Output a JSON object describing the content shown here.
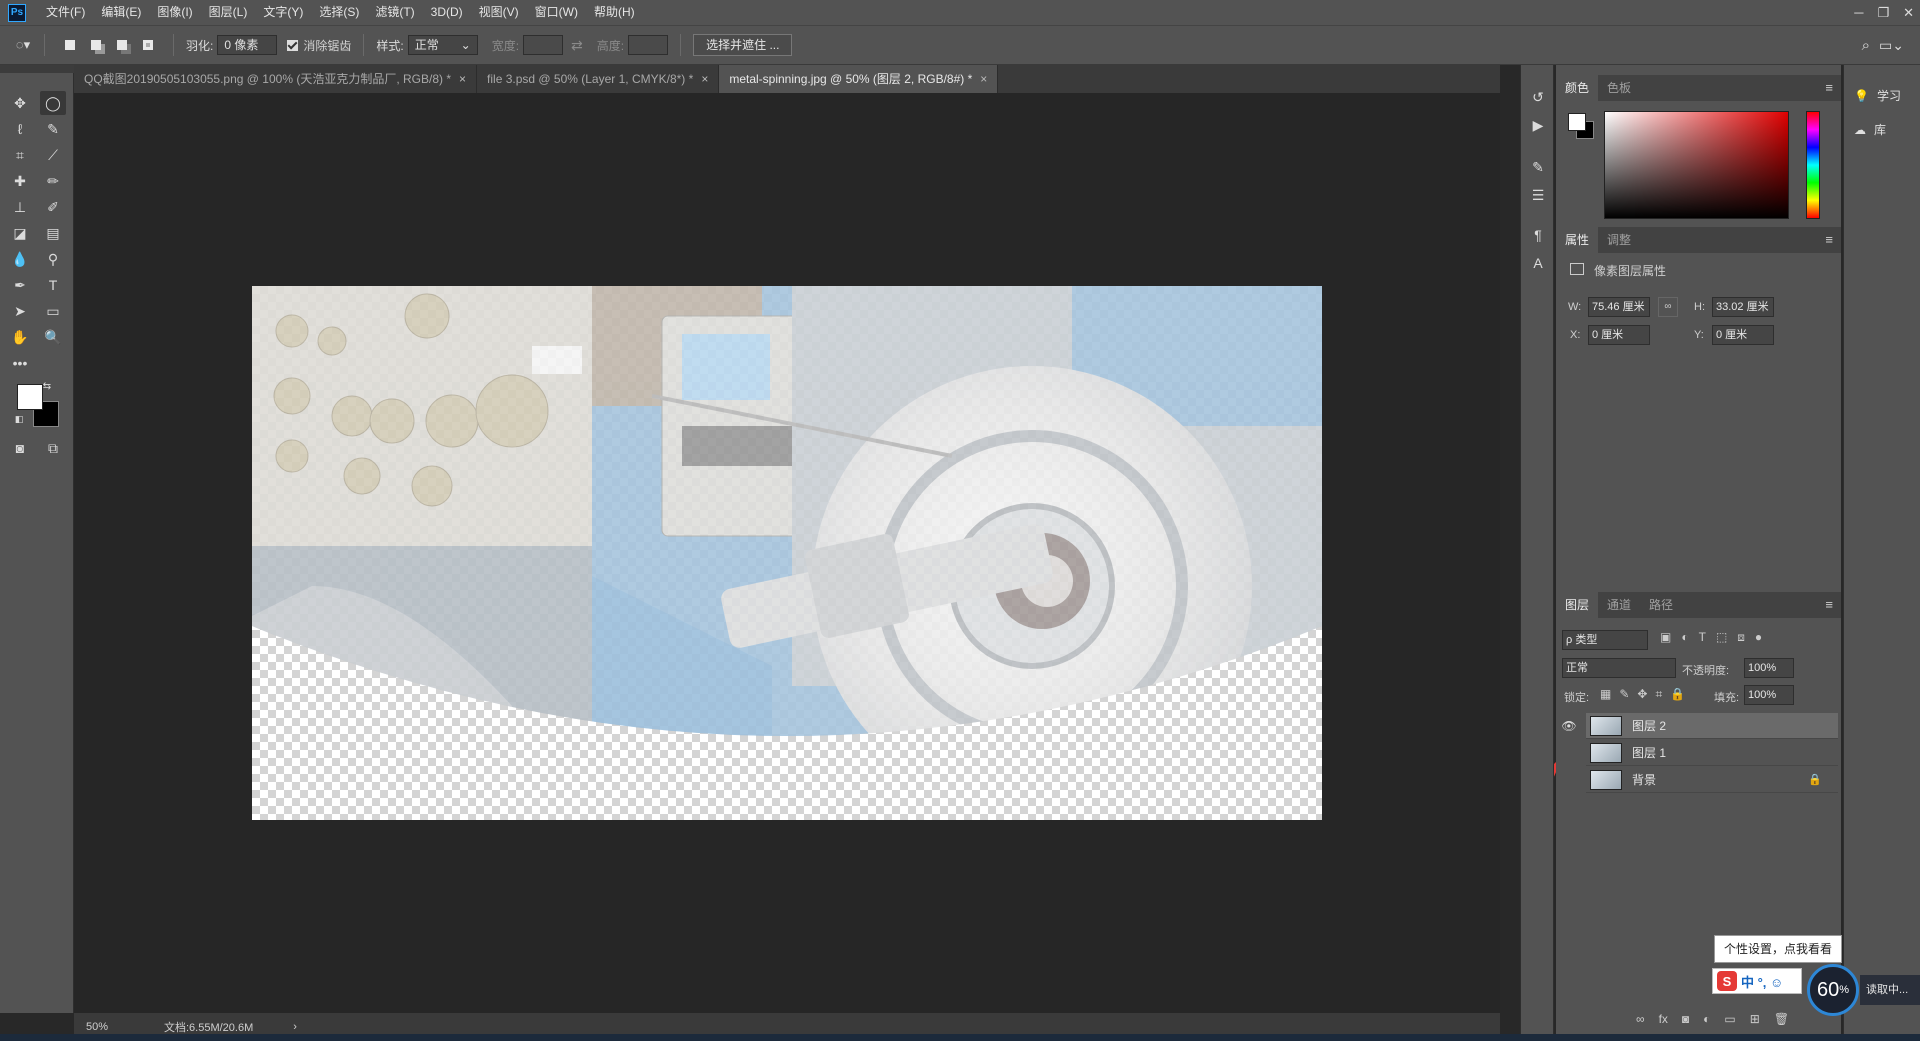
{
  "app": {
    "logo": "Ps"
  },
  "menu": [
    "文件(F)",
    "编辑(E)",
    "图像(I)",
    "图层(L)",
    "文字(Y)",
    "选择(S)",
    "滤镜(T)",
    "3D(D)",
    "视图(V)",
    "窗口(W)",
    "帮助(H)"
  ],
  "window_controls": {
    "minimize": "─",
    "restore": "❐",
    "close": "✕"
  },
  "options": {
    "feather_label": "羽化:",
    "feather_value": "0 像素",
    "antialias_label": "消除锯齿",
    "style_label": "样式:",
    "style_value": "正常",
    "width_label": "宽度:",
    "height_label": "高度:",
    "select_mask_button": "选择并遮住 ..."
  },
  "tabs": [
    {
      "label": "QQ截图20190505103055.png @ 100% (天浩亚克力制品厂, RGB/8) *",
      "close": "×"
    },
    {
      "label": "file 3.psd @ 50% (Layer 1, CMYK/8*) *",
      "close": "×"
    },
    {
      "label": "metal-spinning.jpg @ 50% (图层 2, RGB/8#) *",
      "close": "×"
    }
  ],
  "status": {
    "zoom": "50%",
    "doc_info": "文档:6.55M/20.6M",
    "arrow": "›"
  },
  "color_panel": {
    "tabs": [
      "颜色",
      "色板"
    ],
    "menu": "≡"
  },
  "properties_panel": {
    "tabs": [
      "属性",
      "调整"
    ],
    "menu": "≡",
    "title": "像素图层属性",
    "w_label": "W:",
    "w_value": "75.46 厘米",
    "h_label": "H:",
    "h_value": "33.02 厘米",
    "x_label": "X:",
    "x_value": "0 厘米",
    "y_label": "Y:",
    "y_value": "0 厘米"
  },
  "layers_panel": {
    "tabs": [
      "图层",
      "通道",
      "路径"
    ],
    "menu": "≡",
    "filter_value": "ρ 类型",
    "blend_mode": "正常",
    "opacity_label": "不透明度:",
    "opacity_value": "100%",
    "lock_label": "锁定:",
    "fill_label": "填充:",
    "fill_value": "100%",
    "layers": [
      {
        "name": "图层 2",
        "visible": true,
        "selected": true
      },
      {
        "name": "图层 1",
        "visible": false,
        "selected": false
      },
      {
        "name": "背景",
        "visible": false,
        "selected": false,
        "locked": true
      }
    ]
  },
  "right_column": {
    "learn": "学习",
    "library": "库"
  },
  "ime": {
    "tip": "个性设置，点我看看",
    "chars": "中 °, ☺"
  },
  "gauge": {
    "value": "60",
    "unit": "%",
    "text": "读取中..."
  },
  "colors": {
    "accent": "#31a8ff",
    "panel": "#535353",
    "canvas_bg": "#262626"
  }
}
